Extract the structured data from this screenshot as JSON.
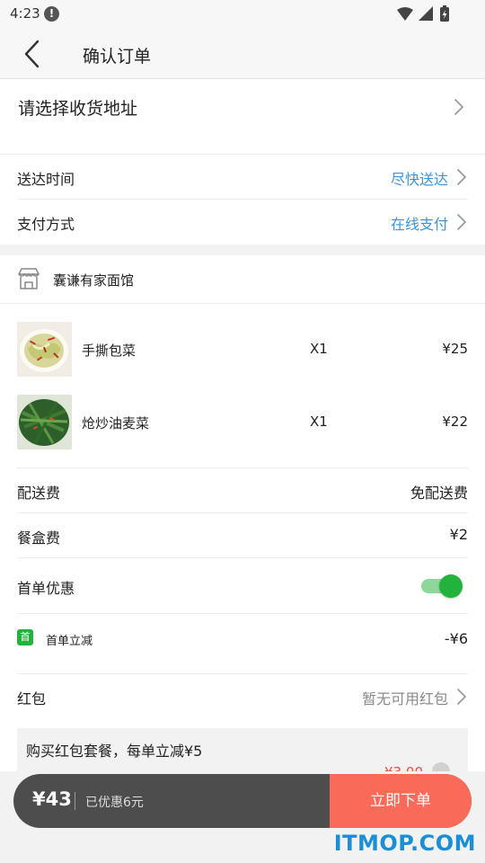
{
  "status_bar": {
    "time": "4:23",
    "alert_icon": "alert-circle-icon"
  },
  "header": {
    "title": "确认订单"
  },
  "address": {
    "label": "请选择收货地址"
  },
  "delivery_time": {
    "label": "送达时间",
    "value": "尽快送达"
  },
  "payment": {
    "label": "支付方式",
    "value": "在线支付"
  },
  "shop": {
    "name": "囊谦有家面馆",
    "icon": "store-icon"
  },
  "items": [
    {
      "name": "手撕包菜",
      "qty": "X1",
      "price": "¥25"
    },
    {
      "name": "炝炒油麦菜",
      "qty": "X1",
      "price": "¥22"
    }
  ],
  "fees": {
    "delivery_label": "配送费",
    "delivery_value": "免配送费",
    "box_label": "餐盒费",
    "box_value": "¥2"
  },
  "first_order": {
    "label": "首单优惠",
    "toggle_on": true,
    "badge": "首",
    "discount_label": "首单立减",
    "discount_value": "-¥6"
  },
  "red_packet": {
    "label": "红包",
    "value": "暂无可用红包",
    "promo_text": "购买红包套餐，每单立减¥5",
    "promo_price": "¥3.00"
  },
  "checkout": {
    "total": "¥43",
    "saved": "已优惠6元",
    "button": "立即下单"
  },
  "watermark": "ITMOP.COM",
  "colors": {
    "accent_blue": "#3b94d9",
    "discount_red": "#f04a3b",
    "toggle_green": "#22b33c",
    "order_button": "#fa6a58",
    "bar_dark": "#4d4d4d"
  }
}
